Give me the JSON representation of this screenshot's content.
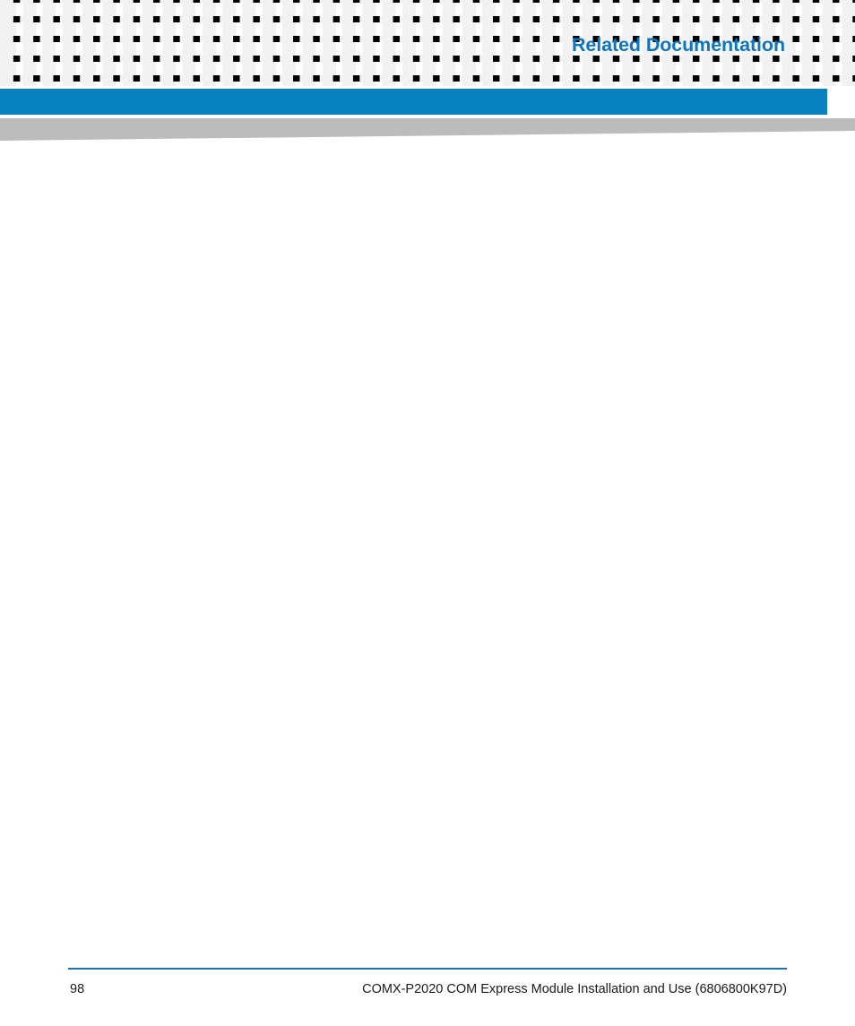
{
  "page": {
    "title": "Related Documentation",
    "title_color": "#0f76bc",
    "background_color": "#ffffff"
  },
  "header": {
    "pattern_name": "square-grid-pattern",
    "pattern_square_color": "#f2f2f2",
    "blue_bar_color": "#0680bf",
    "gray_swoosh_color": "#bcbcbc"
  },
  "body": {
    "content": ""
  },
  "footer": {
    "rule_color": "#1b76b0",
    "page_number": "98",
    "document_title": "COMX-P2020 COM Express Module Installation and Use (6806800K97D)"
  }
}
